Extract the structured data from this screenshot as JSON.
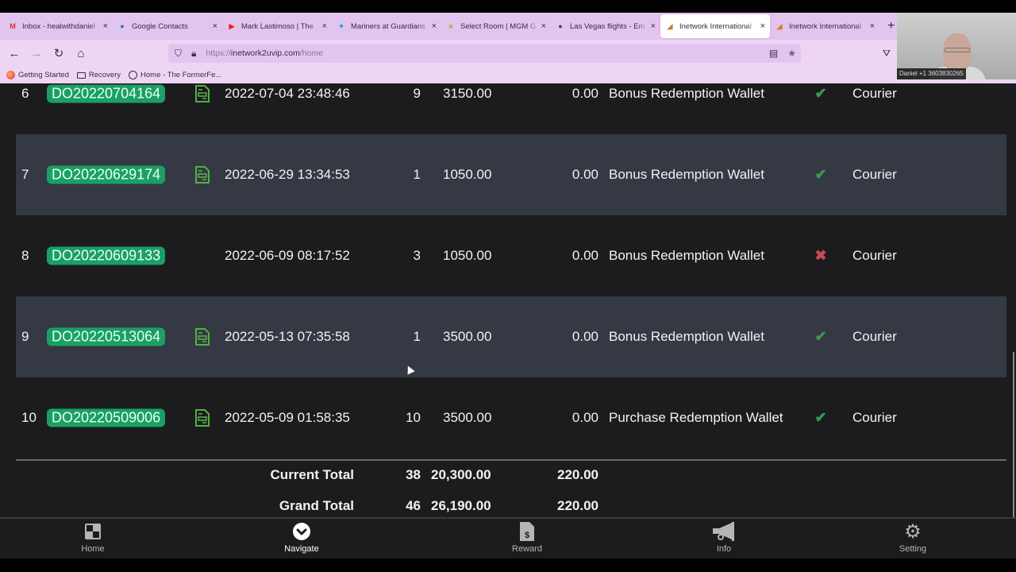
{
  "browser": {
    "tabs": [
      {
        "title": "Inbox - healwithdaniel",
        "icon": "gmail-icon",
        "glyph": "M",
        "color": "#d93025"
      },
      {
        "title": "Google Contacts",
        "icon": "contacts-icon",
        "glyph": "●",
        "color": "#1a73e8"
      },
      {
        "title": "Mark Lastimoso | The",
        "icon": "youtube-icon",
        "glyph": "▶",
        "color": "#e62117"
      },
      {
        "title": "Mariners at Guardians",
        "icon": "twitter-icon",
        "glyph": "✦",
        "color": "#1d9bf0"
      },
      {
        "title": "Select Room | MGM G",
        "icon": "mgm-icon",
        "glyph": "■",
        "color": "#c9a86a"
      },
      {
        "title": "Las Vegas flights - Em",
        "icon": "airline-icon",
        "glyph": "●",
        "color": "#1f4e79"
      },
      {
        "title": "Inetwork International",
        "icon": "inetwork-icon",
        "glyph": "◢",
        "color": "#c9831f",
        "active": true
      },
      {
        "title": "Inetwork International",
        "icon": "inetwork-icon",
        "glyph": "◢",
        "color": "#c9831f"
      }
    ],
    "close_glyph": "×",
    "newtab_glyph": "+",
    "url_prefix": "https://",
    "url_domain": "inetwork2uvip.com",
    "url_path": "/home",
    "bookmarks": [
      "Getting Started",
      "Recovery",
      "Home - The FormerFe..."
    ]
  },
  "webcam": {
    "label": "Daniel +1 3603830265"
  },
  "orders": {
    "rows": [
      {
        "index": "6",
        "order_id": "DO20220704164",
        "has_doc": true,
        "datetime": "2022-07-04 23:48:46",
        "qty": "9",
        "amount": "3150.00",
        "fee": "0.00",
        "wallet": "Bonus Redemption Wallet",
        "status": "ok",
        "shipping": "Courier"
      },
      {
        "index": "7",
        "order_id": "DO20220629174",
        "has_doc": true,
        "datetime": "2022-06-29 13:34:53",
        "qty": "1",
        "amount": "1050.00",
        "fee": "0.00",
        "wallet": "Bonus Redemption Wallet",
        "status": "ok",
        "shipping": "Courier"
      },
      {
        "index": "8",
        "order_id": "DO20220609133",
        "has_doc": false,
        "datetime": "2022-06-09 08:17:52",
        "qty": "3",
        "amount": "1050.00",
        "fee": "0.00",
        "wallet": "Bonus Redemption Wallet",
        "status": "no",
        "shipping": "Courier"
      },
      {
        "index": "9",
        "order_id": "DO20220513064",
        "has_doc": true,
        "datetime": "2022-05-13 07:35:58",
        "qty": "1",
        "amount": "3500.00",
        "fee": "0.00",
        "wallet": "Bonus Redemption Wallet",
        "status": "ok",
        "shipping": "Courier"
      },
      {
        "index": "10",
        "order_id": "DO20220509006",
        "has_doc": true,
        "datetime": "2022-05-09 01:58:35",
        "qty": "10",
        "amount": "3500.00",
        "fee": "0.00",
        "wallet": "Purchase Redemption Wallet",
        "status": "ok",
        "shipping": "Courier"
      }
    ],
    "status_glyphs": {
      "ok": "✔",
      "no": "✖"
    },
    "totals": [
      {
        "label": "Current Total",
        "qty": "38",
        "amount": "20,300.00",
        "fee": "220.00"
      },
      {
        "label": "Grand Total",
        "qty": "46",
        "amount": "26,190.00",
        "fee": "220.00"
      }
    ]
  },
  "bottom_nav": [
    {
      "label": "Home",
      "icon": "home-icon"
    },
    {
      "label": "Navigate",
      "icon": "navigate-icon",
      "active": true
    },
    {
      "label": "Reward",
      "icon": "reward-icon"
    },
    {
      "label": "Info",
      "icon": "megaphone-icon"
    },
    {
      "label": "Setting",
      "icon": "gear-icon"
    }
  ],
  "colors": {
    "order_badge": "#1aa065",
    "ok": "#3d9a4e",
    "no": "#c84b5a",
    "row_alt": "#343943",
    "bg": "#1c1c1e",
    "chrome": "#e3c4ef"
  }
}
